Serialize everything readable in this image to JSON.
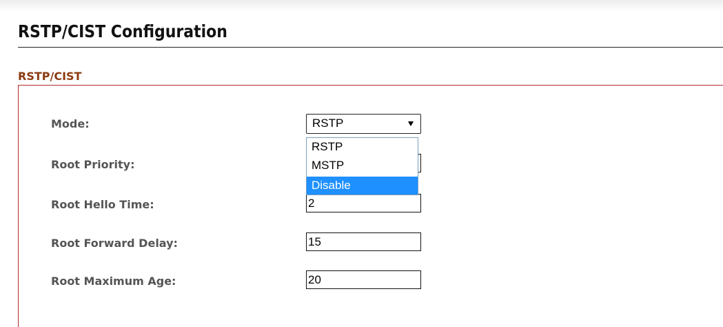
{
  "page": {
    "title": "RSTP/CIST Configuration"
  },
  "section": {
    "title": "RSTP/CIST"
  },
  "form": {
    "mode": {
      "label": "Mode:",
      "selected": "RSTP",
      "options": [
        "RSTP",
        "MSTP",
        "Disable"
      ],
      "highlighted": "Disable"
    },
    "root_priority": {
      "label": "Root Priority:",
      "value": ""
    },
    "root_hello_time": {
      "label": "Root Hello Time:",
      "value": "2"
    },
    "root_forward_delay": {
      "label": "Root Forward Delay:",
      "value": "15"
    },
    "root_maximum_age": {
      "label": "Root Maximum Age:",
      "value": "20"
    }
  },
  "colors": {
    "section_title": "#8b3a10",
    "section_border": "#b22a2a",
    "label": "#555555",
    "highlight": "#1e90ff"
  },
  "icons": {
    "select_arrow": "chevron-down-icon"
  }
}
